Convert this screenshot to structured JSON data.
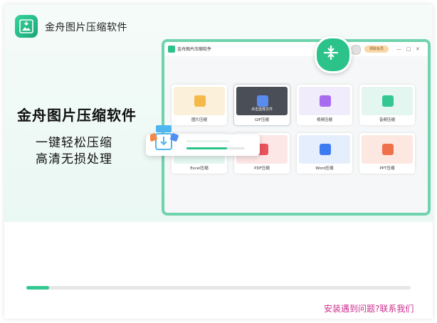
{
  "app": {
    "title": "金舟图片压缩软件"
  },
  "hero": {
    "headline": "金舟图片压缩软件",
    "tagline1": "一键轻松压缩",
    "tagline2": "高清无损处理"
  },
  "mock_window": {
    "title": "金舟图片压缩软件",
    "vip_label": "领取会员",
    "controls": [
      "—",
      "□",
      "✕"
    ],
    "cards": [
      {
        "label": "图片压缩",
        "thumb_color": "#fbf1da",
        "icon_color": "#f5b94a",
        "icon": "image-icon"
      },
      {
        "label": "GIF压缩",
        "thumb_color": "#4a4f57",
        "icon_color": "#5a8cf0",
        "icon": "gif-icon",
        "hover_text": "点击选择文件"
      },
      {
        "label": "视频压缩",
        "thumb_color": "#f1ecfb",
        "icon_color": "#a66bef",
        "icon": "video-icon"
      },
      {
        "label": "音频压缩",
        "thumb_color": "#e3f6ef",
        "icon_color": "#34c792",
        "icon": "audio-icon"
      },
      {
        "label": "Excel压缩",
        "thumb_color": "#e3f6ef",
        "icon_color": "#2cb07a",
        "icon": "excel-icon"
      },
      {
        "label": "PDF压缩",
        "thumb_color": "#fde6e6",
        "icon_color": "#e9545b",
        "icon": "pdf-icon"
      },
      {
        "label": "Word压缩",
        "thumb_color": "#e5eefc",
        "icon_color": "#3d7bf0",
        "icon": "word-icon"
      },
      {
        "label": "PPT压缩",
        "thumb_color": "#fde8e1",
        "icon_color": "#f0704a",
        "icon": "ppt-icon"
      }
    ]
  },
  "popup": {
    "progress": 0.7
  },
  "install": {
    "progress": 0.06
  },
  "help": {
    "link": "安装遇到问题?联系我们"
  },
  "colors": {
    "accent": "#2cc38a",
    "link": "#cc2f8e",
    "border": "#6fd3ad"
  }
}
